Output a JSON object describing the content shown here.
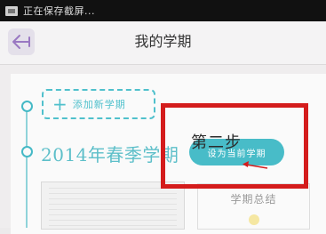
{
  "status_bar": {
    "text": "正在保存截屏..."
  },
  "header": {
    "title": "我的学期"
  },
  "timeline": {
    "add_term_label": "添加新学期",
    "term_title": "2014年春季学期",
    "set_current_label": "设为当前学期"
  },
  "annotation": {
    "step_label": "第二步"
  },
  "summary_card": {
    "title": "学期总结"
  },
  "colors": {
    "accent": "#45b9c6",
    "highlight": "#d41c1c",
    "back_button_bg": "#e4e0ea"
  }
}
